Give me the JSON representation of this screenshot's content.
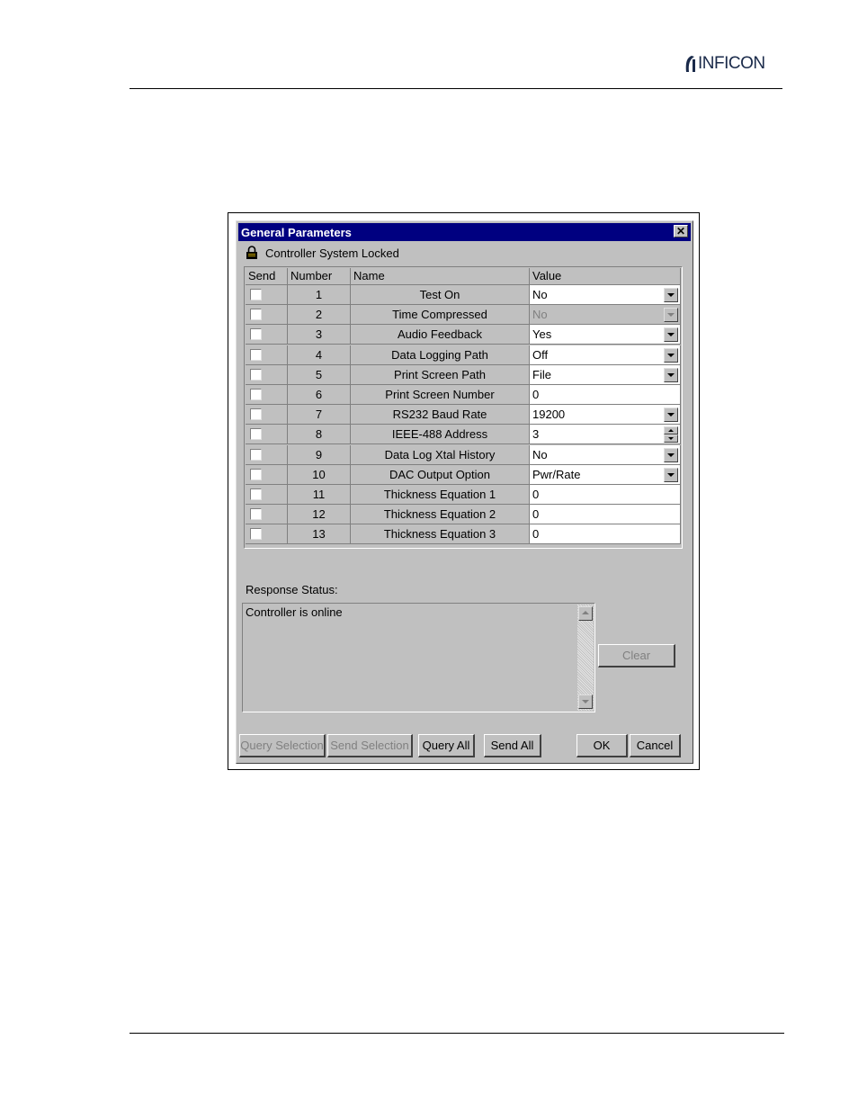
{
  "brand": {
    "logo_text": "INFICON"
  },
  "dialog": {
    "title": "General Parameters",
    "close_label": "✕",
    "status_line": "Controller System Locked",
    "columns": [
      "Send",
      "Number",
      "Name",
      "Value"
    ],
    "rows": [
      {
        "number": "1",
        "name": "Test On",
        "value": "No",
        "control": "dropdown"
      },
      {
        "number": "2",
        "name": "Time Compressed",
        "value": "No",
        "control": "dropdown-disabled"
      },
      {
        "number": "3",
        "name": "Audio Feedback",
        "value": "Yes",
        "control": "dropdown"
      },
      {
        "number": "4",
        "name": "Data Logging Path",
        "value": "Off",
        "control": "dropdown"
      },
      {
        "number": "5",
        "name": "Print Screen Path",
        "value": "File",
        "control": "dropdown"
      },
      {
        "number": "6",
        "name": "Print Screen Number",
        "value": "0",
        "control": "text"
      },
      {
        "number": "7",
        "name": "RS232 Baud Rate",
        "value": "19200",
        "control": "dropdown"
      },
      {
        "number": "8",
        "name": "IEEE-488 Address",
        "value": "3",
        "control": "spinner"
      },
      {
        "number": "9",
        "name": "Data Log Xtal History",
        "value": "No",
        "control": "dropdown"
      },
      {
        "number": "10",
        "name": "DAC Output Option",
        "value": "Pwr/Rate",
        "control": "dropdown"
      },
      {
        "number": "11",
        "name": "Thickness Equation 1",
        "value": "0",
        "control": "text"
      },
      {
        "number": "12",
        "name": "Thickness Equation 2",
        "value": "0",
        "control": "text"
      },
      {
        "number": "13",
        "name": "Thickness Equation 3",
        "value": "0",
        "control": "text"
      }
    ],
    "response_label": "Response Status:",
    "response_text": "Controller is online",
    "buttons": {
      "clear": "Clear",
      "query_selection": "Query Selection",
      "send_selection": "Send Selection",
      "query_all": "Query All",
      "send_all": "Send All",
      "ok": "OK",
      "cancel": "Cancel"
    }
  }
}
